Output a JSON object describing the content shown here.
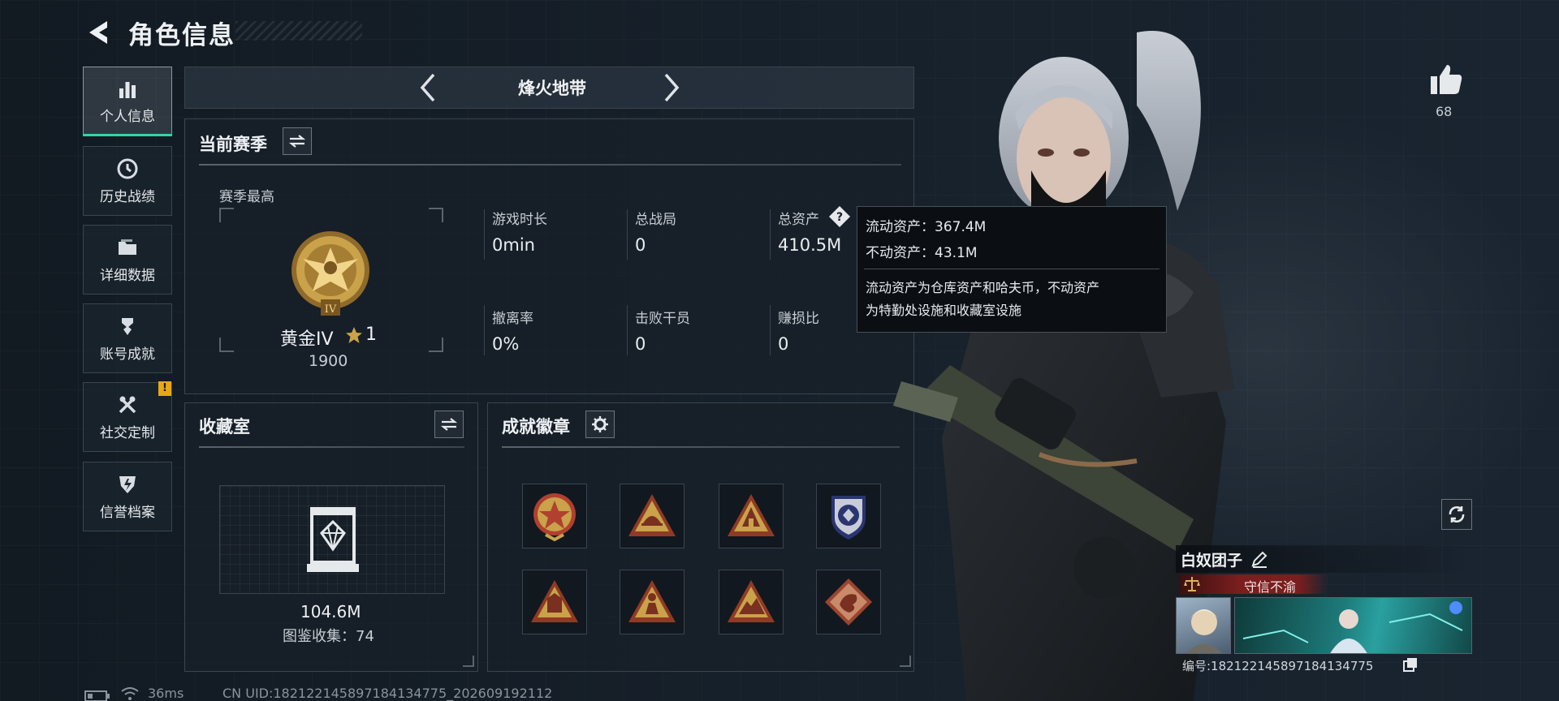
{
  "header": {
    "title": "角色信息"
  },
  "sidebar": {
    "items": [
      {
        "label": "个人信息",
        "icon": "bar-chart-icon",
        "active": true
      },
      {
        "label": "历史战绩",
        "icon": "clock-icon"
      },
      {
        "label": "详细数据",
        "icon": "folder-icon"
      },
      {
        "label": "账号成就",
        "icon": "trophy-icon"
      },
      {
        "label": "社交定制",
        "icon": "tools-icon",
        "alert": "!"
      },
      {
        "label": "信誉档案",
        "icon": "shield-icon"
      }
    ]
  },
  "mode": {
    "label": "烽火地带"
  },
  "season": {
    "title": "当前赛季",
    "best_label": "赛季最高",
    "rank_name": "黄金IV",
    "rank_stars": "1",
    "rank_score": "1900",
    "rank_numeral": "IV",
    "stats": [
      {
        "label": "游戏时长",
        "value": "0min"
      },
      {
        "label": "总战局",
        "value": "0"
      },
      {
        "label": "总资产",
        "value": "410.5M"
      },
      {
        "label": "撤离率",
        "value": "0%"
      },
      {
        "label": "击败干员",
        "value": "0"
      },
      {
        "label": "赚损比",
        "value": "0"
      }
    ]
  },
  "tooltip": {
    "liquid": "流动资产：367.4M",
    "fixed": "不动资产：43.1M",
    "desc1": "流动资产为仓库资产和哈夫币，不动资产",
    "desc2": "为特勤处设施和收藏室设施"
  },
  "collection": {
    "title": "收藏室",
    "value": "104.6M",
    "count": "图鉴收集：74"
  },
  "badges": {
    "title": "成就徽章",
    "items": [
      "red-star-medal-icon",
      "triangle-helmet-badge-icon",
      "triangle-bunker-badge-icon",
      "blue-emblem-badge-icon",
      "triangle-warehouse-badge-icon",
      "triangle-soldier-badge-icon",
      "triangle-mountain-badge-icon",
      "dragon-diamond-badge-icon"
    ]
  },
  "likes": {
    "count": "68"
  },
  "profile": {
    "name": "白奴团子",
    "title": "守信不渝",
    "id": "编号:182122145897184134775"
  },
  "status": {
    "ping": "36ms",
    "uid": "CN UID:182122145897184134775_202609192112"
  },
  "colors": {
    "accent": "#2fd7a6",
    "gold": "#c9a24a",
    "alert": "#e6a817",
    "title_red": "#7a1e1e"
  }
}
